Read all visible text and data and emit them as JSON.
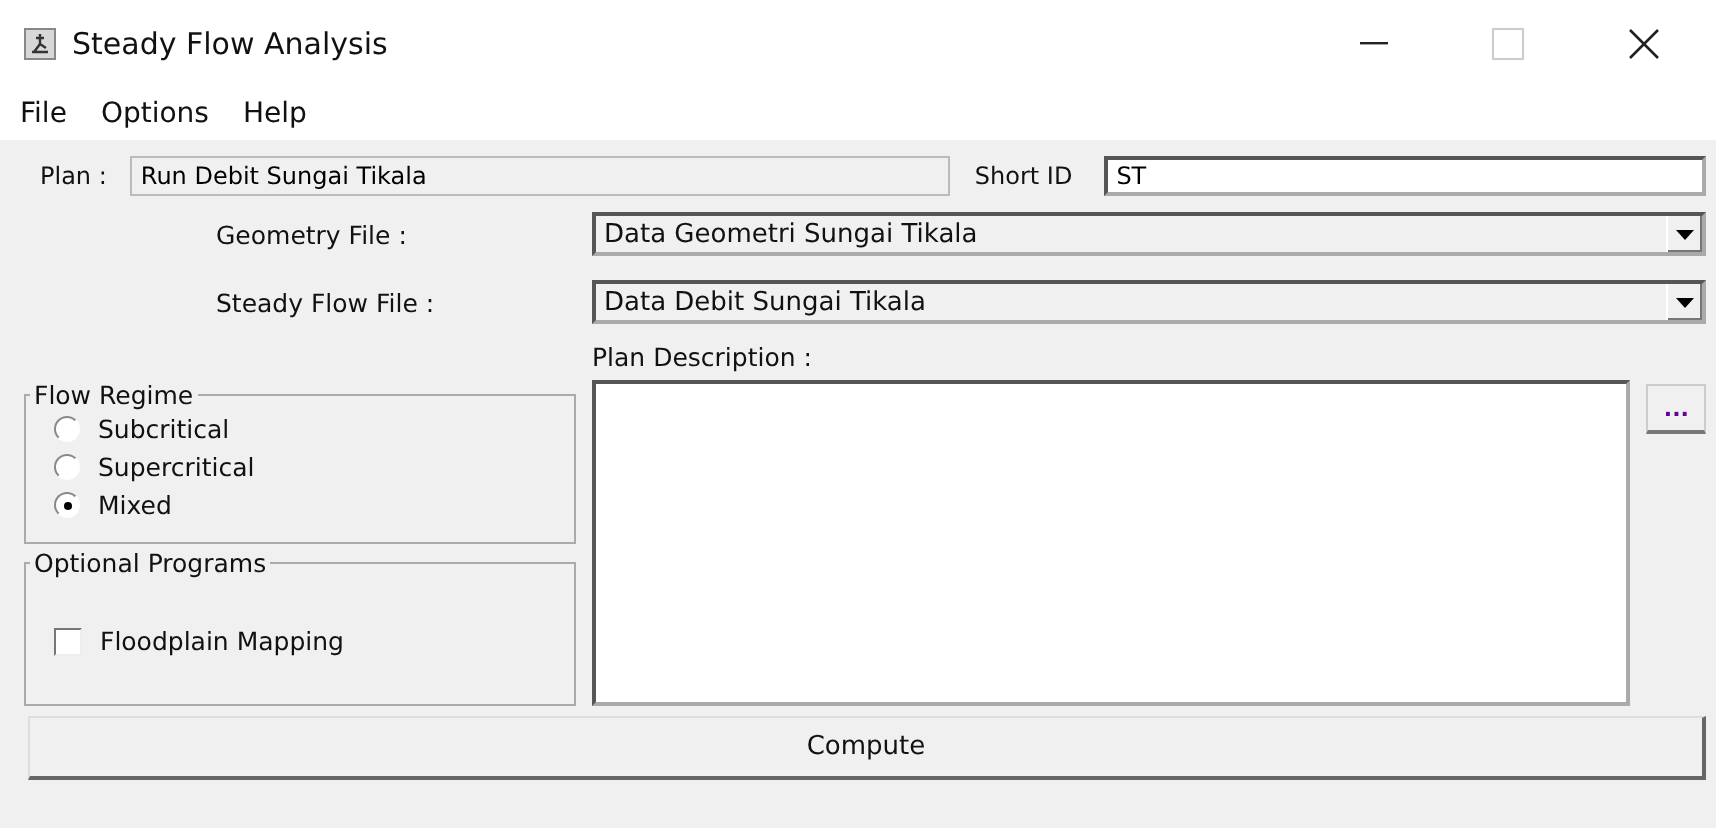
{
  "window": {
    "title": "Steady Flow Analysis"
  },
  "menu": [
    "File",
    "Options",
    "Help"
  ],
  "plan": {
    "label": "Plan :",
    "value": "Run Debit Sungai Tikala"
  },
  "short_id": {
    "label": "Short ID",
    "value": "ST"
  },
  "dropdowns": [
    {
      "label": "Geometry File :",
      "value": "Data Geometri Sungai Tikala"
    },
    {
      "label": "Steady Flow File :",
      "value": "Data Debit Sungai Tikala"
    }
  ],
  "plan_description": {
    "label": "Plan Description :"
  },
  "ellipsis_button": "...",
  "flow_regime": {
    "title": "Flow Regime",
    "options": [
      {
        "label": "Subcritical",
        "selected": false
      },
      {
        "label": "Supercritical",
        "selected": false
      },
      {
        "label": "Mixed",
        "selected": true
      }
    ]
  },
  "optional_programs": {
    "title": "Optional Programs",
    "items": [
      {
        "label": "Floodplain Mapping",
        "checked": false
      }
    ]
  },
  "compute_button": "Compute"
}
